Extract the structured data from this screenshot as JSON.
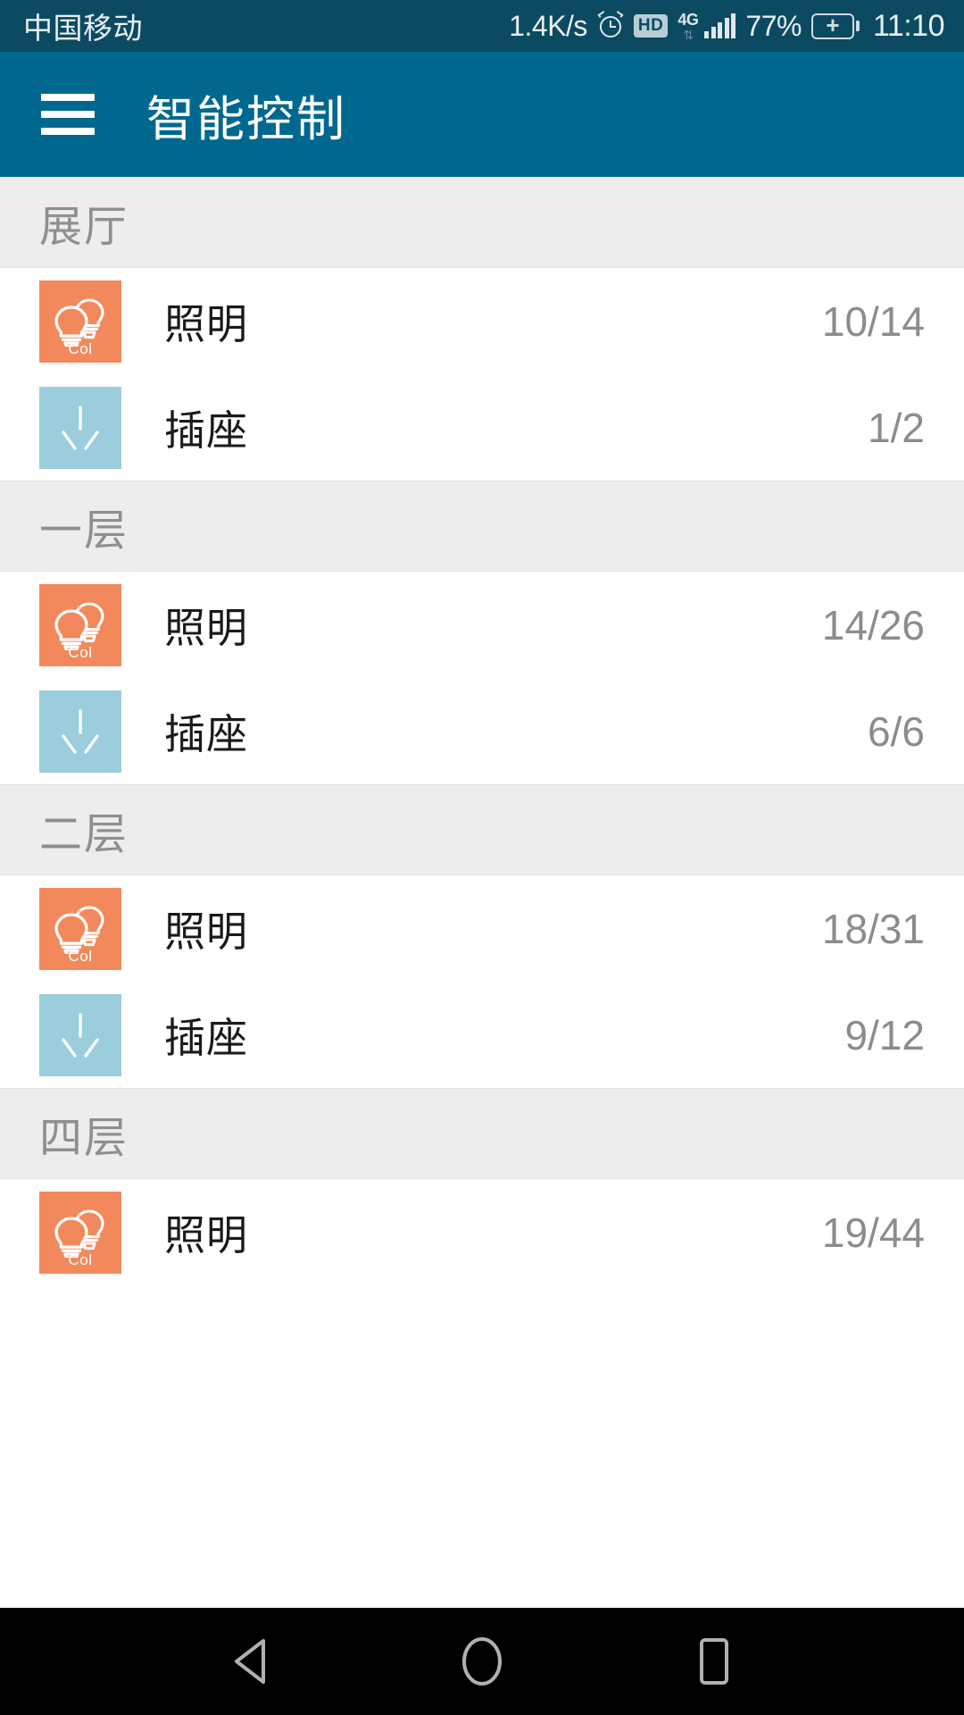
{
  "status_bar": {
    "carrier": "中国移动",
    "network_speed": "1.4K/s",
    "alarm_icon": "alarm-clock-icon",
    "hd_label": "HD",
    "network_type": "4G",
    "data_arrows": "⇅",
    "battery_percent": "77%",
    "battery_state_icon": "battery-charging-icon",
    "time": "11:10"
  },
  "app_bar": {
    "menu_icon": "hamburger-menu-icon",
    "title": "智能控制"
  },
  "colors": {
    "status_bar_bg": "#0c4a61",
    "app_bar_bg": "#00688f",
    "section_bg": "#ededed",
    "lighting_icon_bg": "#f2895c",
    "socket_icon_bg": "#9bcddc",
    "count_text": "#8c8c8c",
    "section_title": "#8f8f8f"
  },
  "sections": [
    {
      "title": "展厅",
      "rows": [
        {
          "icon": "lighting-bulbs-icon",
          "icon_caption": "Col",
          "label": "照明",
          "count": "10/14"
        },
        {
          "icon": "power-socket-icon",
          "icon_caption": "",
          "label": "插座",
          "count": "1/2"
        }
      ]
    },
    {
      "title": "一层",
      "rows": [
        {
          "icon": "lighting-bulbs-icon",
          "icon_caption": "Col",
          "label": "照明",
          "count": "14/26"
        },
        {
          "icon": "power-socket-icon",
          "icon_caption": "",
          "label": "插座",
          "count": "6/6"
        }
      ]
    },
    {
      "title": "二层",
      "rows": [
        {
          "icon": "lighting-bulbs-icon",
          "icon_caption": "Col",
          "label": "照明",
          "count": "18/31"
        },
        {
          "icon": "power-socket-icon",
          "icon_caption": "",
          "label": "插座",
          "count": "9/12"
        }
      ]
    },
    {
      "title": "四层",
      "rows": [
        {
          "icon": "lighting-bulbs-icon",
          "icon_caption": "Col",
          "label": "照明",
          "count": "19/44"
        }
      ]
    }
  ],
  "nav_bar": {
    "back_icon": "back-triangle-icon",
    "home_icon": "home-circle-icon",
    "recents_icon": "recents-square-icon"
  }
}
